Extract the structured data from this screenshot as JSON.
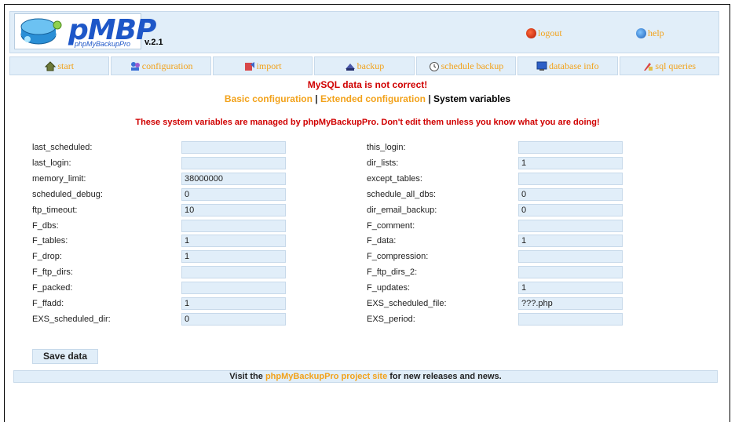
{
  "header": {
    "logo_text": "pMBP",
    "logo_subtitle": "phpMyBackupPro",
    "version": "v.2.1",
    "logout_label": "logout",
    "help_label": "help",
    "logout_icon": "power-icon",
    "help_icon": "help-icon"
  },
  "tabs": [
    {
      "label": "start",
      "icon": "home-icon"
    },
    {
      "label": "configuration",
      "icon": "people-icon"
    },
    {
      "label": "import",
      "icon": "import-icon"
    },
    {
      "label": "backup",
      "icon": "backup-icon"
    },
    {
      "label": "schedule backup",
      "icon": "clock-icon"
    },
    {
      "label": "database info",
      "icon": "database-icon"
    },
    {
      "label": "sql queries",
      "icon": "sql-icon"
    }
  ],
  "messages": {
    "error": "MySQL data is not correct!",
    "warning": "These system variables are managed by phpMyBackupPro. Don't edit them unless you know what you are doing!"
  },
  "subnav": {
    "basic": "Basic configuration",
    "sep1": " | ",
    "extended": "Extended configuration",
    "sep2": " | ",
    "current": "System variables"
  },
  "vars_left": [
    {
      "label": "last_scheduled:",
      "value": ""
    },
    {
      "label": "last_login:",
      "value": ""
    },
    {
      "label": "memory_limit:",
      "value": "38000000"
    },
    {
      "label": "scheduled_debug:",
      "value": "0"
    },
    {
      "label": "ftp_timeout:",
      "value": "10"
    },
    {
      "label": "F_dbs:",
      "value": ""
    },
    {
      "label": "F_tables:",
      "value": "1"
    },
    {
      "label": "F_drop:",
      "value": "1"
    },
    {
      "label": "F_ftp_dirs:",
      "value": ""
    },
    {
      "label": "F_packed:",
      "value": ""
    },
    {
      "label": "F_ffadd:",
      "value": "1"
    },
    {
      "label": "EXS_scheduled_dir:",
      "value": "0"
    }
  ],
  "vars_right": [
    {
      "label": "this_login:",
      "value": ""
    },
    {
      "label": "dir_lists:",
      "value": "1"
    },
    {
      "label": "except_tables:",
      "value": ""
    },
    {
      "label": "schedule_all_dbs:",
      "value": "0"
    },
    {
      "label": "dir_email_backup:",
      "value": "0"
    },
    {
      "label": "F_comment:",
      "value": ""
    },
    {
      "label": "F_data:",
      "value": "1"
    },
    {
      "label": "F_compression:",
      "value": ""
    },
    {
      "label": "F_ftp_dirs_2:",
      "value": ""
    },
    {
      "label": "F_updates:",
      "value": "1"
    },
    {
      "label": "EXS_scheduled_file:",
      "value": "???.php"
    },
    {
      "label": "EXS_period:",
      "value": ""
    }
  ],
  "save_label": "Save data",
  "footer": {
    "prefix": "Visit the ",
    "link": "phpMyBackupPro project site",
    "suffix": " for new releases and news."
  },
  "colors": {
    "accent": "#f2a21b",
    "panel": "#e1eef9",
    "error": "#d00000",
    "brand": "#1e57c8"
  }
}
